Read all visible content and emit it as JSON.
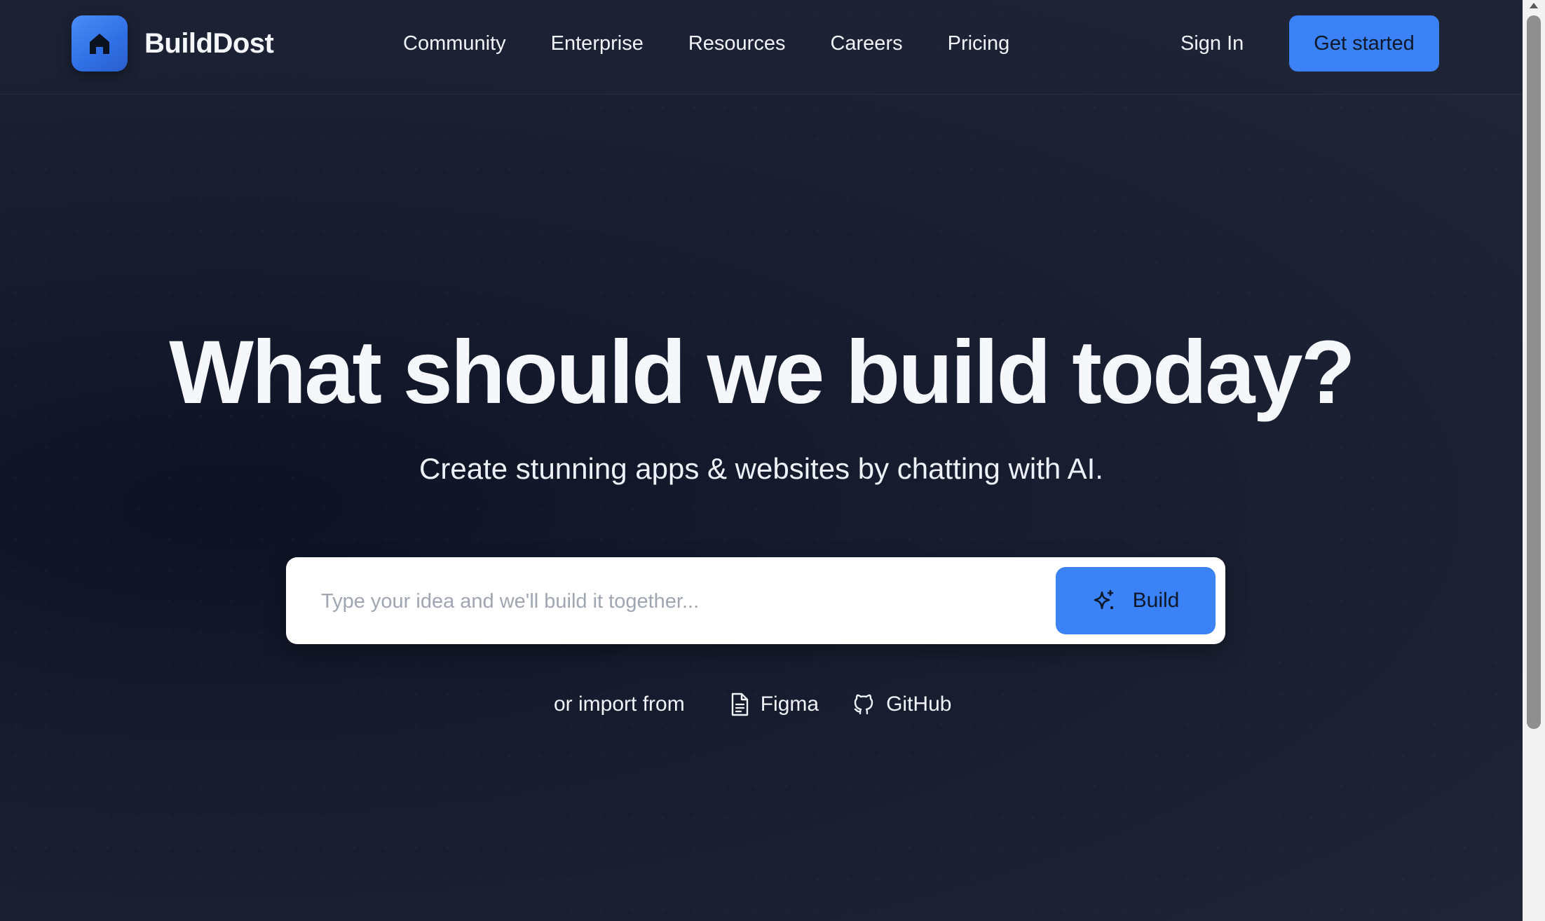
{
  "header": {
    "brand": "BuildDost",
    "nav": [
      "Community",
      "Enterprise",
      "Resources",
      "Careers",
      "Pricing"
    ],
    "sign_in": "Sign In",
    "get_started": "Get started"
  },
  "hero": {
    "title": "What should we build today?",
    "subtitle": "Create stunning apps & websites by chatting with AI."
  },
  "search": {
    "placeholder": "Type your idea and we'll build it together...",
    "value": "",
    "build_label": "Build"
  },
  "import": {
    "label": "or import from",
    "figma": "Figma",
    "github": "GitHub"
  },
  "colors": {
    "accent": "#3b82f6",
    "background": "#1c2234"
  },
  "icons": {
    "logo": "house-icon",
    "build": "sparkle-icon",
    "figma": "file-icon",
    "github": "github-icon"
  }
}
